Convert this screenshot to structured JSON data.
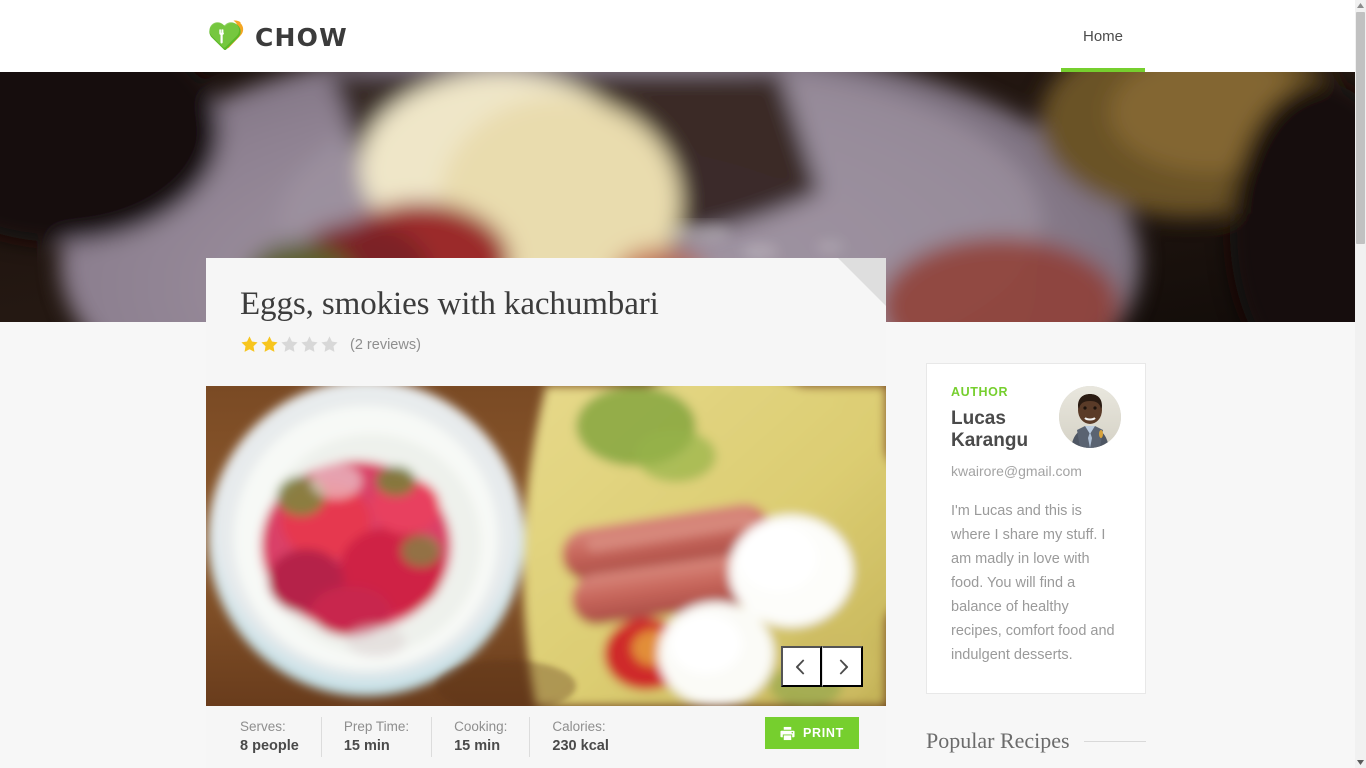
{
  "site": {
    "logo_text": "CHOW",
    "logo_icon": "heart-fork-icon",
    "brand_green": "#76cf2e",
    "brand_orange": "#f5a623"
  },
  "nav": {
    "items": [
      {
        "label": "Home",
        "active": true
      }
    ]
  },
  "hero": {
    "alt": "dark blurred photo of food on a plate",
    "background_color": "#1d1411"
  },
  "recipe": {
    "title": "Eggs, smokies with kachumbari",
    "rating": {
      "filled": 2,
      "total": 5,
      "reviews_text": "(2 reviews)",
      "filled_color": "#f7c51e",
      "empty_color": "#d8d8d8"
    },
    "carousel": {
      "alt": "bowl of kachumbari salad next to smokies and boiled eggs",
      "prev_icon": "chevron-left-icon",
      "next_icon": "chevron-right-icon"
    },
    "meta": [
      {
        "label": "Serves:",
        "value": "8 people"
      },
      {
        "label": "Prep Time:",
        "value": "15 min"
      },
      {
        "label": "Cooking:",
        "value": "15 min"
      },
      {
        "label": "Calories:",
        "value": "230 kcal"
      }
    ],
    "print_button": {
      "label": "PRINT",
      "icon": "printer-icon",
      "color": "#76cf2e"
    }
  },
  "sidebar": {
    "author": {
      "label": "AUTHOR",
      "name": "Lucas Karangu",
      "email": "kwairore@gmail.com",
      "bio": "I'm Lucas and this is where I share my stuff. I am madly in love with food. You will find a balance of healthy recipes, comfort food and indulgent desserts.",
      "avatar_alt": "portrait photo of Lucas Karangu"
    },
    "popular_recipes": {
      "title": "Popular Recipes"
    }
  },
  "browser": {
    "scrollbar": {
      "up_icon": "scroll-up-arrow-icon",
      "down_icon": "scroll-down-arrow-icon"
    }
  }
}
